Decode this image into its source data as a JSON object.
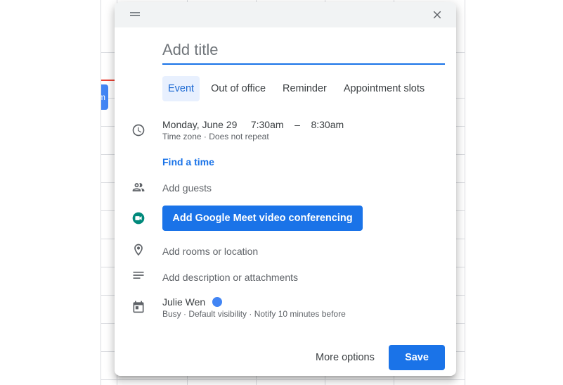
{
  "dialog": {
    "title_placeholder": "Add title",
    "tabs": [
      {
        "label": "Event",
        "active": true
      },
      {
        "label": "Out of office",
        "active": false
      },
      {
        "label": "Reminder",
        "active": false
      },
      {
        "label": "Appointment slots",
        "active": false
      }
    ],
    "datetime": {
      "date": "Monday, June 29",
      "start": "7:30am",
      "separator": "–",
      "end": "8:30am",
      "timezone_label": "Time zone",
      "dot": "·",
      "repeat_label": "Does not repeat"
    },
    "find_time_label": "Find a time",
    "guests_label": "Add guests",
    "meet_button_label": "Add Google Meet video conferencing",
    "location_label": "Add rooms or location",
    "description_label": "Add description or attachments",
    "calendar_owner": {
      "name": "Julie Wen",
      "color": "#4285f4",
      "details": "Busy · Default visibility · Notify 10 minutes before"
    },
    "more_options_label": "More options",
    "save_label": "Save"
  },
  "background": {
    "event_chip_text": "m"
  },
  "colors": {
    "accent": "#1a73e8",
    "active_tab_bg": "#e8f0fe",
    "meet_green": "#00897b"
  },
  "icons": {
    "header": [
      "drag-handle-icon",
      "close-icon"
    ],
    "rows": [
      "clock-icon",
      "people-icon",
      "google-meet-icon",
      "location-pin-icon",
      "notes-icon",
      "calendar-icon"
    ]
  }
}
